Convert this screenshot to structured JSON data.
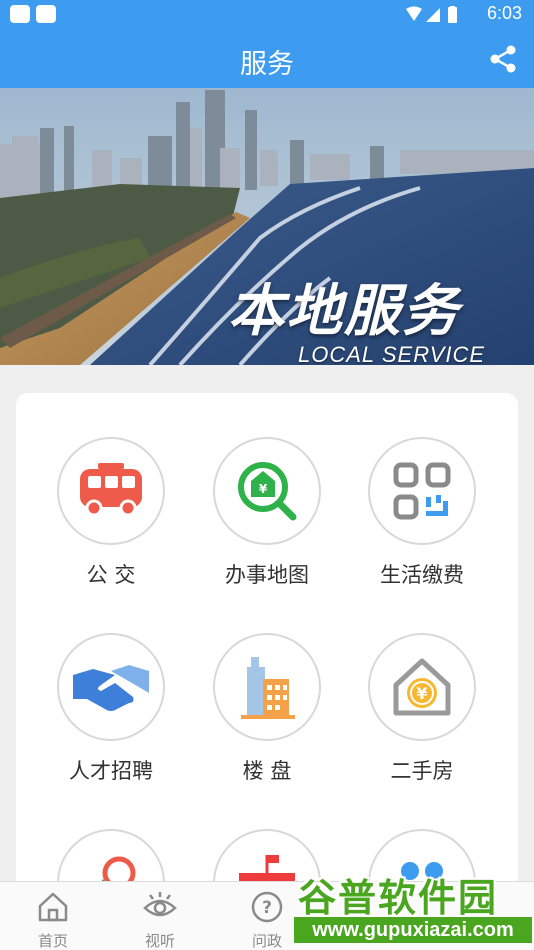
{
  "status_bar": {
    "time": "6:03"
  },
  "app_bar": {
    "title": "服务"
  },
  "banner": {
    "title_cn": "本地服务",
    "title_en": "LOCAL SERVICE"
  },
  "services": [
    {
      "label": "公 交",
      "icon": "bus-icon"
    },
    {
      "label": "办事地图",
      "icon": "map-search-icon"
    },
    {
      "label": "生活缴费",
      "icon": "qr-payment-icon"
    },
    {
      "label": "人才招聘",
      "icon": "handshake-icon"
    },
    {
      "label": "楼 盘",
      "icon": "building-icon"
    },
    {
      "label": "二手房",
      "icon": "house-coin-icon"
    }
  ],
  "bottom_nav": [
    {
      "label": "首页",
      "icon": "home-icon"
    },
    {
      "label": "视听",
      "icon": "eye-icon"
    },
    {
      "label": "问政",
      "icon": "question-icon"
    }
  ],
  "watermark": {
    "line1": "谷普软件园",
    "line2": "www.gupuxiazai.com"
  },
  "colors": {
    "primary": "#3d9bf0",
    "watermark_green": "#4aa51f"
  }
}
